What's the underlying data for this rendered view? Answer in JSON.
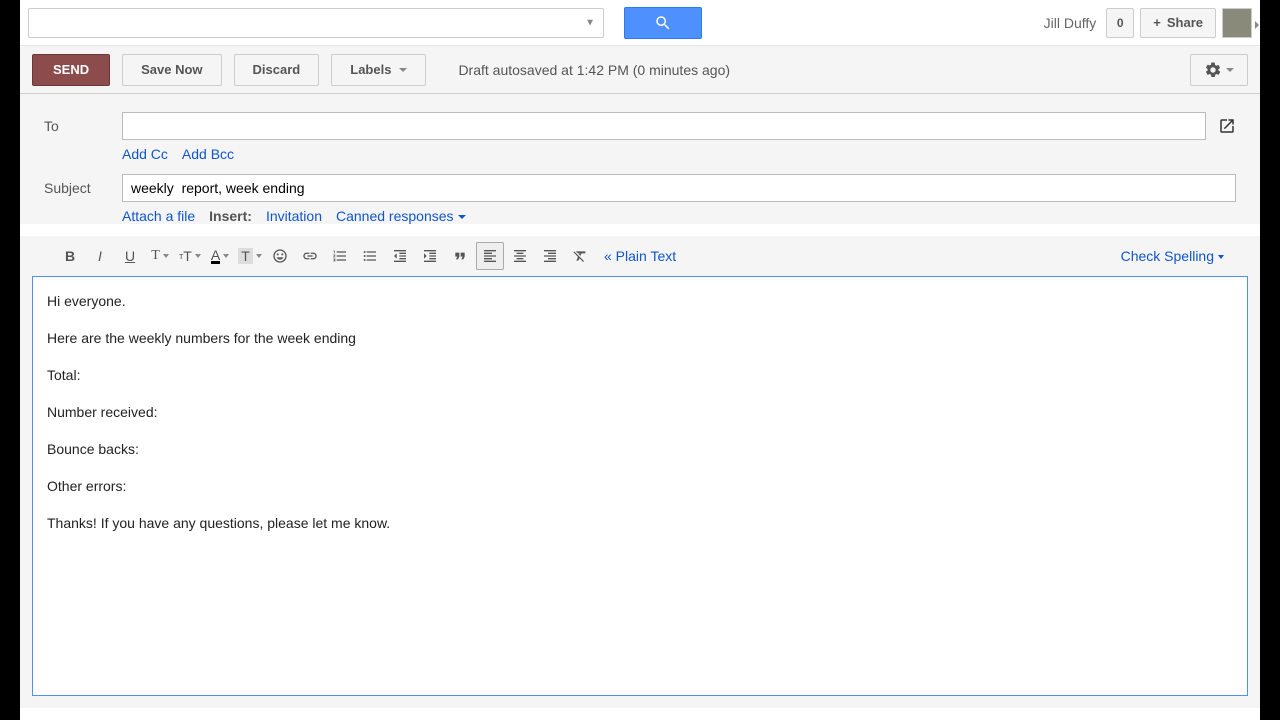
{
  "topbar": {
    "user_name": "Jill Duffy",
    "badge_count": "0",
    "share_label": "Share"
  },
  "actions": {
    "send": "SEND",
    "save": "Save Now",
    "discard": "Discard",
    "labels": "Labels",
    "autosave": "Draft autosaved at 1:42 PM (0 minutes ago)"
  },
  "compose": {
    "to_label": "To",
    "add_cc": "Add Cc",
    "add_bcc": "Add Bcc",
    "subject_label": "Subject",
    "subject_value": "weekly  report, week ending",
    "attach": "Attach a file",
    "insert_label": "Insert:",
    "invitation": "Invitation",
    "canned": "Canned responses"
  },
  "toolbar": {
    "plain_text": "« Plain Text",
    "check_spelling": "Check Spelling"
  },
  "body": {
    "p1": "Hi everyone.",
    "p2": "Here are the weekly numbers for the week ending",
    "p3": "Total:",
    "p4": "Number received:",
    "p5": "Bounce backs:",
    "p6": "Other errors:",
    "p7": "Thanks! If you have any questions, please let me know."
  }
}
